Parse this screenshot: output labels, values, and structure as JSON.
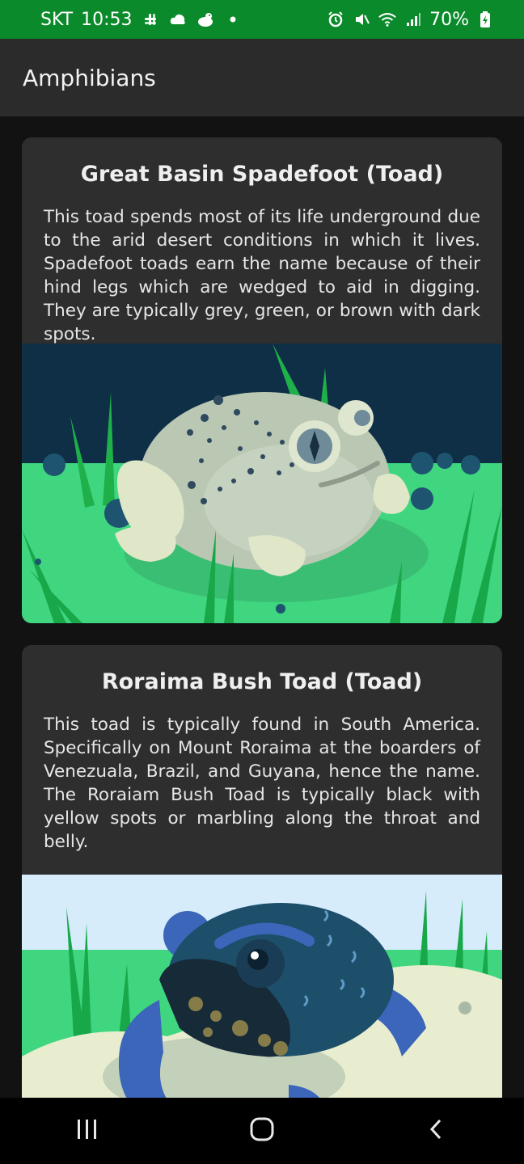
{
  "status_bar": {
    "carrier": "SKT",
    "time": "10:53",
    "battery": "70%"
  },
  "app_bar": {
    "title": "Amphibians"
  },
  "cards": [
    {
      "title": "Great Basin Spadefoot (Toad)",
      "description": "This toad spends most of its life underground due to the arid desert conditions in which it lives. Spadefoot toads earn the name because of their hind legs which are wedged to aid in digging. They are typically grey, green, or brown with dark spots."
    },
    {
      "title": "Roraima Bush Toad (Toad)",
      "description": "This toad is typically found in South America. Specifically on Mount Roraima at the boarders of Venezuala, Brazil, and Guyana, hence the name. The Roraiam Bush Toad is typically black with yellow spots or marbling along the throat and belly."
    }
  ],
  "icons": {
    "status_left": [
      "slack-icon",
      "cloud-icon",
      "duck-icon",
      "dot-icon"
    ],
    "status_right": [
      "alarm-icon",
      "mute-icon",
      "wifi-icon",
      "signal-icon",
      "battery-icon"
    ],
    "nav": [
      "recents-icon",
      "home-icon",
      "back-icon"
    ]
  },
  "colors": {
    "status_bar": "#0a8a2a",
    "app_bar": "#2b2b2b",
    "card": "#2e2e2e",
    "background": "#121212"
  }
}
